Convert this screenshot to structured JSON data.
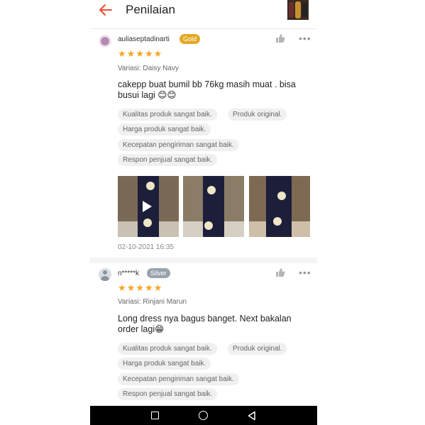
{
  "header": {
    "title": "Penilaian"
  },
  "reviews": [
    {
      "username": "auliaseptadinarti",
      "badge": "Gold",
      "stars": "★★★★★",
      "variant": "Variasi: Daisy Navy",
      "comment": "cakepp buat bumil bb 76kg masih muat . bisa busui lagi 😊😊",
      "tags": [
        "Kualitas produk sangat baik.",
        "Produk original.",
        "Harga produk sangat baik.",
        "Kecepatan pengiriman sangat baik.",
        "Respon penjual sangat baik."
      ],
      "date": "02-10-2021 16:35"
    },
    {
      "username": "n*****k",
      "badge": "Silver",
      "stars": "★★★★★",
      "variant": "Variasi: Rinjani Marun",
      "comment": "Long dress nya bagus banget. Next bakalan order lagi😁",
      "tags": [
        "Kualitas produk sangat baik.",
        "Produk original.",
        "Harga produk sangat baik.",
        "Kecepatan pengiriman sangat baik.",
        "Respon penjual sangat baik."
      ]
    }
  ],
  "colors": {
    "accent": "#ee4d2d",
    "star": "#f5a623",
    "gold": "#e4a826",
    "silver": "#9aa3ad"
  }
}
